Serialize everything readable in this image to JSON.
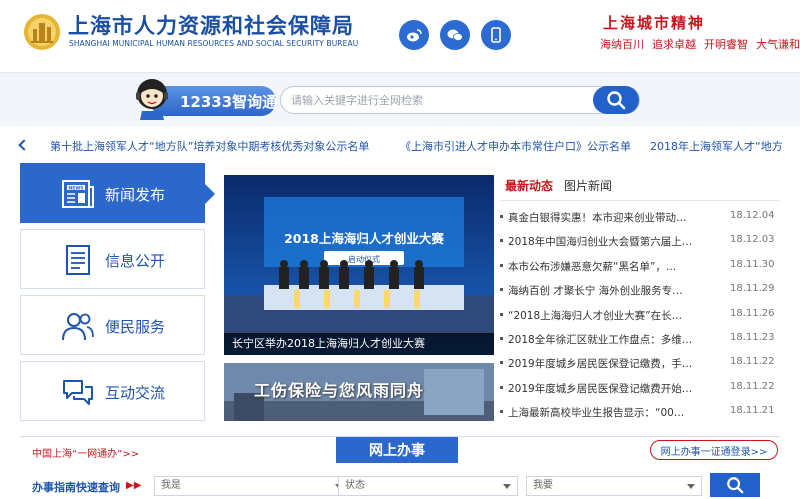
{
  "header": {
    "org_name_cn": "上海市人力资源和社会保障局",
    "org_name_en": "SHANGHAI MUNICIPAL HUMAN RESOURCES AND SOCIAL SECURITY BUREAU",
    "social_icons": [
      "weibo-icon",
      "wechat-icon",
      "mobile-icon"
    ],
    "spirit_title": "上海城市精神",
    "spirit_tags": [
      "海纳百川",
      "追求卓越",
      "开明睿智",
      "大气谦和"
    ]
  },
  "search": {
    "assistant_label": "12333智询通",
    "placeholder": "请输入关键字进行全网检索"
  },
  "ticker": {
    "items": [
      "第十批上海领军人才“地方队”培养对象中期考核优秀对象公示名单",
      "《上海市引进人才申办本市常住户口》公示名单",
      "2018年上海领军人才“地方"
    ]
  },
  "nav": {
    "items": [
      {
        "label": "新闻发布",
        "active": true
      },
      {
        "label": "信息公开",
        "active": false
      },
      {
        "label": "便民服务",
        "active": false
      },
      {
        "label": "互动交流",
        "active": false
      }
    ]
  },
  "feature": {
    "banner_title": "2018上海海归人才创业大赛",
    "banner_sub": "启动仪式",
    "caption": "长宁区举办2018上海海归人才创业大赛",
    "banner2_text": "工伤保险与您风雨同舟"
  },
  "news": {
    "tabs": [
      "最新动态",
      "图片新闻"
    ],
    "items": [
      {
        "title": "真金白银得实惠！本市迎来创业带动…",
        "date": "18.12.04"
      },
      {
        "title": "2018年中国海归创业大会暨第六届上…",
        "date": "18.12.03"
      },
      {
        "title": "本市公布涉嫌恶意欠薪“黑名单”，…",
        "date": "18.11.30"
      },
      {
        "title": "海纳百创 才聚长宁 海外创业服务专…",
        "date": "18.11.29"
      },
      {
        "title": "“2018上海海归人才创业大赛”在长…",
        "date": "18.11.26"
      },
      {
        "title": "2018全年徐汇区就业工作盘点：多维…",
        "date": "18.11.23"
      },
      {
        "title": "2019年度城乡居民医保登记缴费，手…",
        "date": "18.11.22"
      },
      {
        "title": "2019年度城乡居民医保登记缴费开始…",
        "date": "18.11.22"
      },
      {
        "title": "上海最新高校毕业生报告显示：“00…",
        "date": "18.11.21"
      }
    ]
  },
  "services": {
    "left_link": "中国上海“一网通办”>>",
    "tab_label": "网上办事",
    "login_link": "网上办事一证通登录>>",
    "quick_label": "办事指南快速查询",
    "quick_arrows": "▶▶",
    "selects": [
      "我是",
      "状态",
      "我要"
    ]
  },
  "colors": {
    "brand_blue": "#2c67cb",
    "accent_red": "#c9161d"
  }
}
